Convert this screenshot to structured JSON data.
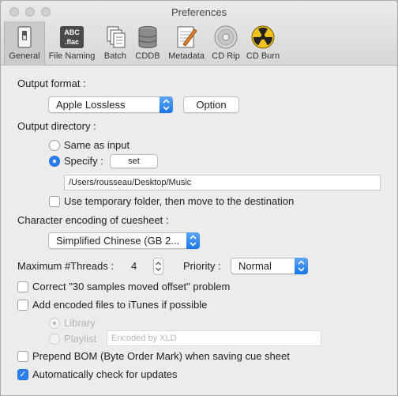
{
  "window": {
    "title": "Preferences"
  },
  "toolbar": {
    "items": [
      {
        "label": "General",
        "icon": "switch-icon"
      },
      {
        "label": "File Naming",
        "icon": "file-naming-icon"
      },
      {
        "label": "Batch",
        "icon": "batch-icon"
      },
      {
        "label": "CDDB",
        "icon": "database-icon"
      },
      {
        "label": "Metadata",
        "icon": "metadata-icon"
      },
      {
        "label": "CD Rip",
        "icon": "cd-icon"
      },
      {
        "label": "CD Burn",
        "icon": "burn-icon"
      }
    ],
    "active": "General",
    "file_naming_badge": [
      "ABC",
      ".flac"
    ]
  },
  "general": {
    "output_format": {
      "label": "Output format :",
      "value": "Apple Lossless",
      "option_button": "Option"
    },
    "output_directory": {
      "label": "Output directory :",
      "same_as_input": "Same as input",
      "specify": "Specify :",
      "set_button": "set",
      "path": "/Users/rousseau/Desktop/Music",
      "temp_folder": "Use temporary folder, then move to the destination"
    },
    "cuesheet_encoding": {
      "label": "Character encoding of cuesheet :",
      "value": "Simplified Chinese (GB 2..."
    },
    "threads": {
      "label": "Maximum #Threads :",
      "value": "4"
    },
    "priority": {
      "label": "Priority :",
      "value": "Normal"
    },
    "correct_offset": "Correct \"30 samples moved offset\" problem",
    "itunes": {
      "label": "Add encoded files to iTunes if possible",
      "library": "Library",
      "playlist": "Playlist",
      "playlist_placeholder": "Encoded by XLD"
    },
    "prepend_bom": "Prepend BOM (Byte Order Mark) when saving cue sheet",
    "auto_update": "Automatically check for updates"
  },
  "colors": {
    "accent": "#2a7ef0",
    "window_bg": "#ececec",
    "disabled_text": "#b6b6b6"
  }
}
